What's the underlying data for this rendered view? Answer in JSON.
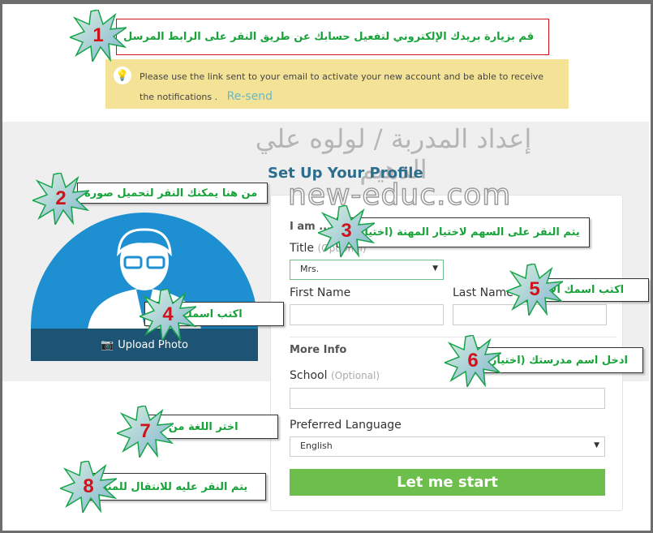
{
  "callouts": {
    "c1": {
      "number": "1",
      "text": "قم بزيارة بريدك الإلكتروني لتفعيل حسابك عن طريق النقر على الرابط المرسل"
    },
    "c2": {
      "number": "2",
      "text": "من هنا يمكنك النقر لتحميل صورة"
    },
    "c3": {
      "number": "3",
      "text": "يتم النقر على السهم لاختيار المهنة (اختياري)"
    },
    "c4": {
      "number": "4",
      "text": "اكتب اسمك الأول"
    },
    "c5": {
      "number": "5",
      "text": "اكتب اسمك الأخير"
    },
    "c6": {
      "number": "6",
      "text": "ادخل اسم  مدرستك (اختياري)"
    },
    "c7": {
      "number": "7",
      "text": "اختر اللغة من هنا"
    },
    "c8": {
      "number": "8",
      "text": "يتم النقر عليه للانتقال للمنصة"
    }
  },
  "alert": {
    "icon": "lightbulb-icon",
    "message": "Please use the link sent to your email to activate your new account and be able to receive the notifications .",
    "resend": "Re-send"
  },
  "watermarks": {
    "author": "إعداد المدربة / لولوه علي الدهيم",
    "site": "new-educ.com"
  },
  "page_title": "Set Up Your Profile",
  "avatar": {
    "upload_label": "Upload Photo"
  },
  "form": {
    "i_am": "I am ...",
    "title_label": "Title",
    "title_optional": "(Optional)",
    "title_value": "Mrs.",
    "first_name_label": "First Name",
    "first_name_value": "",
    "last_name_label": "Last Name",
    "last_name_value": "",
    "more_info": "More Info",
    "school_label": "School",
    "school_optional": "(Optional)",
    "school_value": "",
    "language_label": "Preferred Language",
    "language_value": "English",
    "submit": "Let me start"
  },
  "colors": {
    "accent": "#2d6e8e",
    "button": "#6cbf4a",
    "alert": "#f4e397",
    "callout_text": "#18a33a",
    "number": "#d0121b"
  }
}
